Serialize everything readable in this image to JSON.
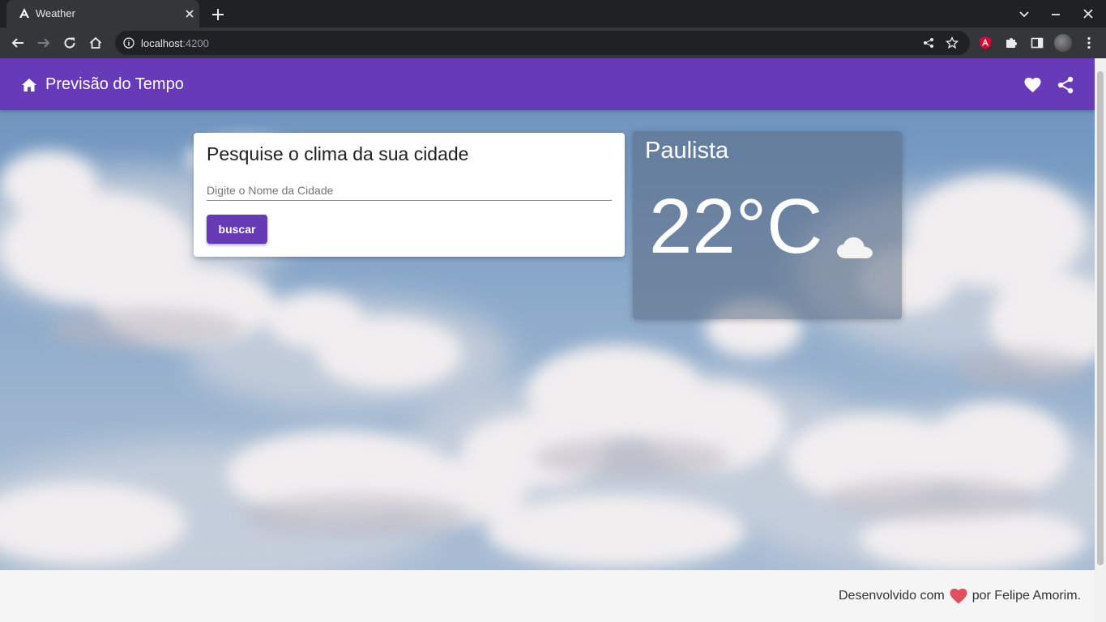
{
  "browser": {
    "tab_title": "Weather",
    "url_host": "localhost",
    "url_port": ":4200"
  },
  "app": {
    "title": "Previsão do Tempo",
    "accent": "#673ab7"
  },
  "search": {
    "title": "Pesquise o clima da sua cidade",
    "placeholder": "Digite o Nome da Cidade",
    "button_label": "buscar"
  },
  "weather": {
    "city": "Paulista",
    "temperature": "22°C",
    "condition_icon": "cloud-icon"
  },
  "footer": {
    "prefix": "Desenvolvido com",
    "suffix": "por Felipe Amorim.",
    "heart_color": "#e0505c"
  }
}
